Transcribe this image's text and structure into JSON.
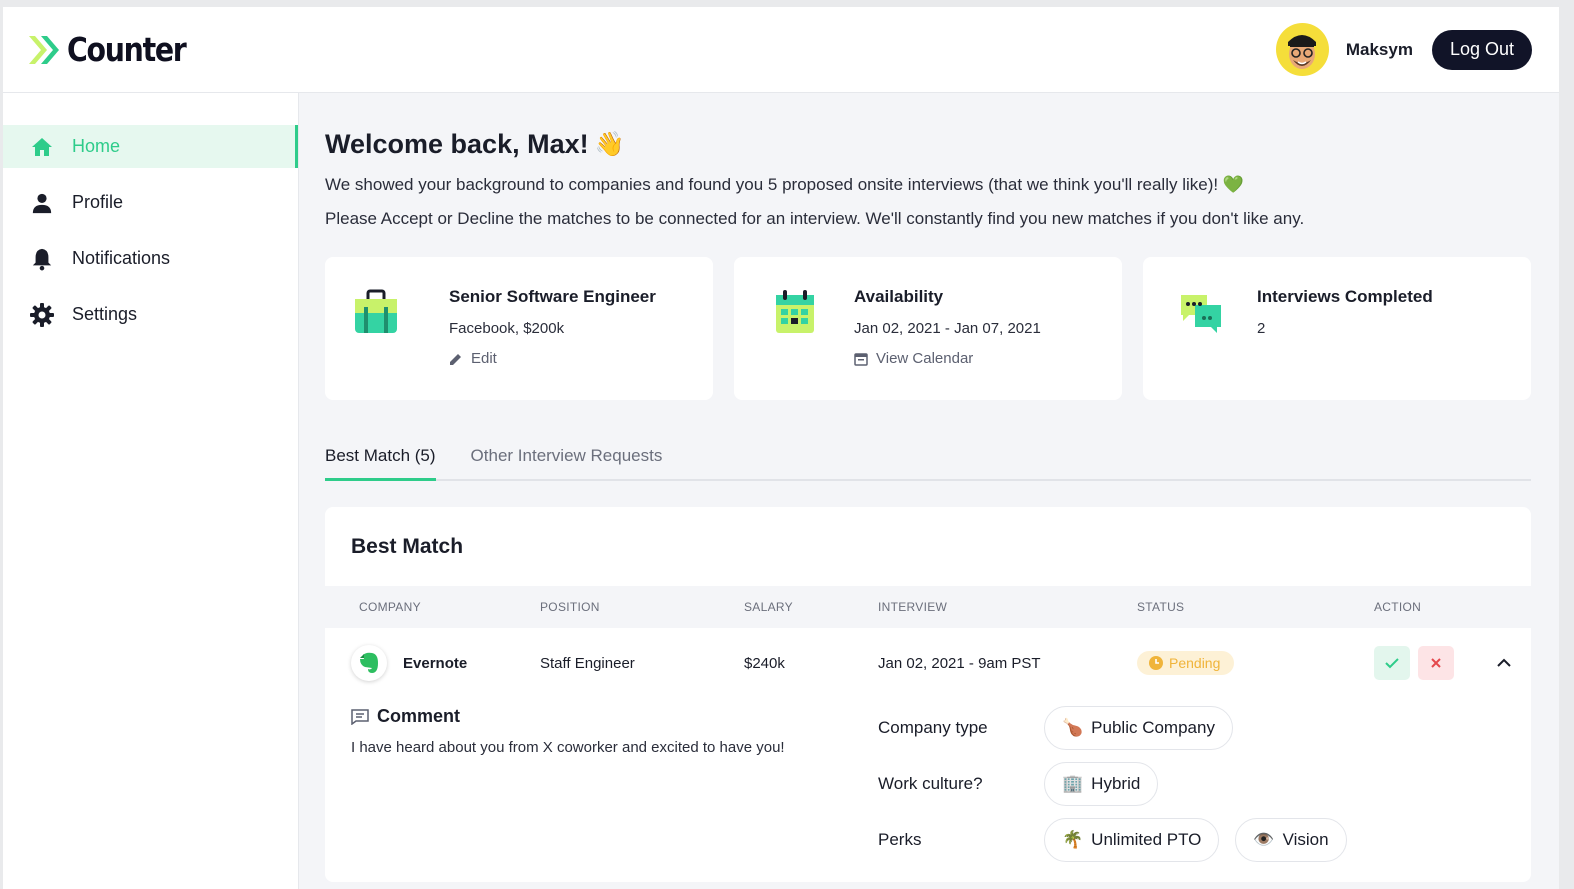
{
  "header": {
    "logo_text": "Counter",
    "username": "Maksym",
    "logout_label": "Log Out"
  },
  "sidebar": {
    "items": [
      {
        "label": "Home",
        "icon": "home-icon",
        "active": true
      },
      {
        "label": "Profile",
        "icon": "person-icon",
        "active": false
      },
      {
        "label": "Notifications",
        "icon": "bell-icon",
        "active": false
      },
      {
        "label": "Settings",
        "icon": "gear-icon",
        "active": false
      }
    ]
  },
  "main": {
    "welcome": "Welcome back, Max!",
    "wave": "👋",
    "intro": "We showed your background to companies and found you 5 proposed onsite interviews (that we think you'll really like)!",
    "heart": "💚",
    "intro2": "Please Accept or Decline the matches to be connected for an interview. We'll constantly find you new matches if you don't like any.",
    "cards": [
      {
        "title": "Senior Software Engineer",
        "sub": "Facebook, $200k",
        "link": "Edit",
        "icon": "briefcase-icon",
        "link_icon": "pencil-icon"
      },
      {
        "title": "Availability",
        "sub": "Jan 02, 2021 - Jan 07, 2021",
        "link": "View Calendar",
        "icon": "calendar-icon",
        "link_icon": "calendar-small-icon"
      },
      {
        "title": "Interviews Completed",
        "sub": "2",
        "icon": "chat-bubbles-icon"
      }
    ],
    "tabs": [
      {
        "label": "Best Match (5)",
        "active": true
      },
      {
        "label": "Other Interview Requests",
        "active": false
      }
    ],
    "panel": {
      "title": "Best Match",
      "columns": [
        "COMPANY",
        "POSITION",
        "SALARY",
        "INTERVIEW",
        "STATUS",
        "ACTION"
      ],
      "rows": [
        {
          "company": "Evernote",
          "position": "Staff Engineer",
          "salary": "$240k",
          "interview": "Jan 02, 2021 - 9am PST",
          "status": "Pending",
          "comment_title": "Comment",
          "comment": "I have heard about you from X coworker and excited to have you!",
          "attributes": [
            {
              "label": "Company type",
              "chips": [
                {
                  "text": "Public Company",
                  "icon": "🍗"
                }
              ]
            },
            {
              "label": "Work culture?",
              "chips": [
                {
                  "text": "Hybrid",
                  "icon": "🏢"
                }
              ]
            },
            {
              "label": "Perks",
              "chips": [
                {
                  "text": "Unlimited PTO",
                  "icon": "🌴"
                },
                {
                  "text": "Vision",
                  "icon": "👁️"
                }
              ]
            }
          ]
        }
      ]
    }
  },
  "colors": {
    "accent": "#2ecc8a",
    "dark": "#111428",
    "pending": "#f0b43a",
    "decline": "#e5484d"
  }
}
